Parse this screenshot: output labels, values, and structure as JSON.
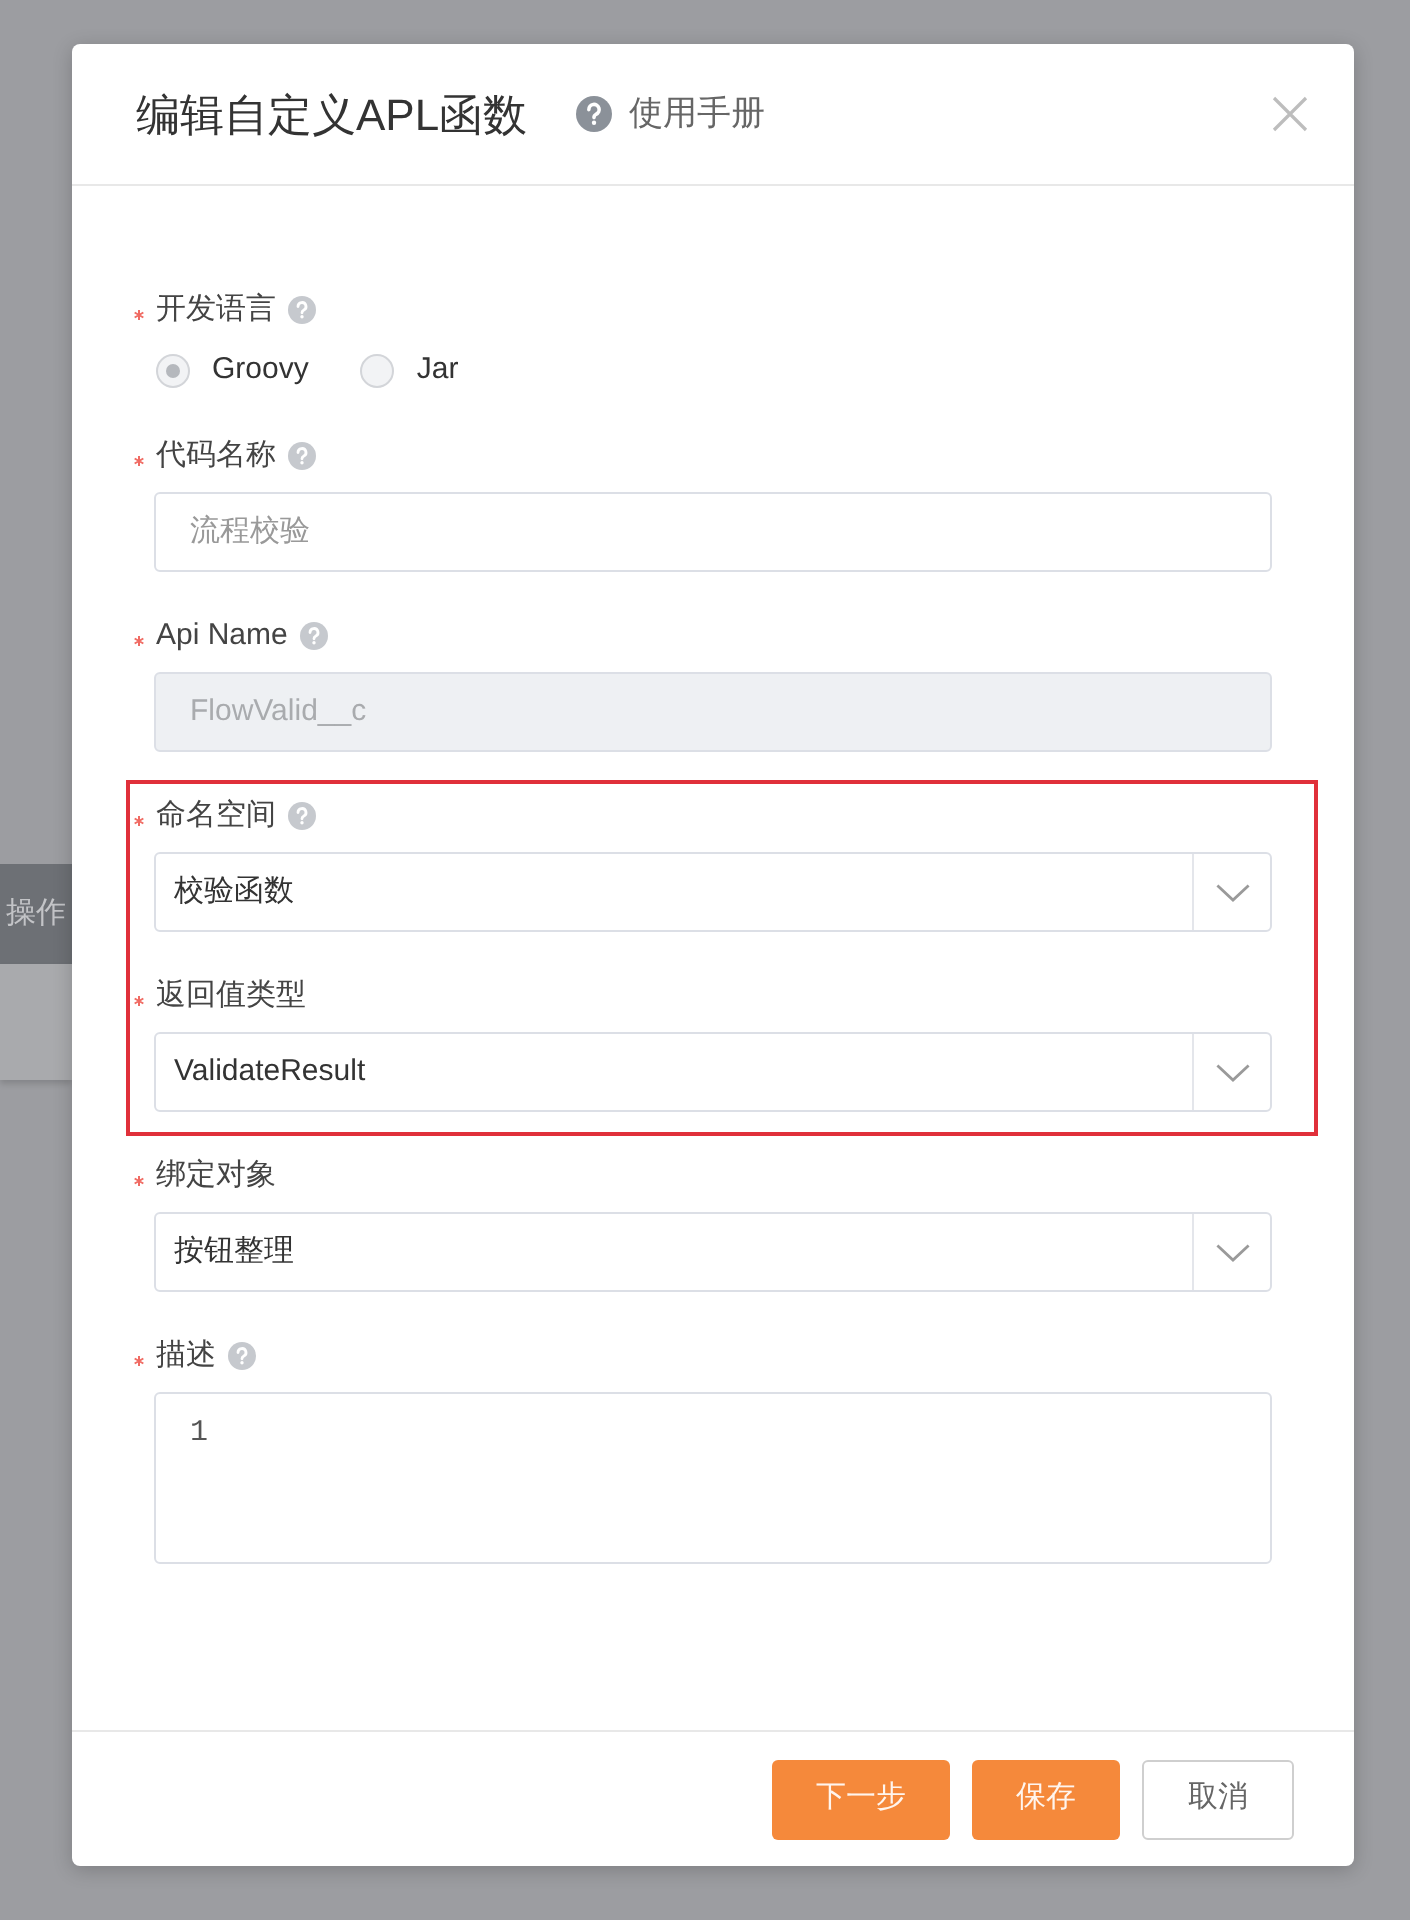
{
  "background": {
    "column_header": "操作"
  },
  "dialog": {
    "title": "编辑自定义APL函数",
    "help_link": "使用手册"
  },
  "fields": [
    {
      "kind": "radio",
      "label": "开发语言",
      "required": true,
      "help": true,
      "highlighted": false,
      "options": [
        {
          "label": "Groovy",
          "selected": true
        },
        {
          "label": "Jar",
          "selected": false
        }
      ]
    },
    {
      "kind": "text",
      "label": "代码名称",
      "required": true,
      "help": true,
      "highlighted": false,
      "value": "流程校验",
      "disabled": false
    },
    {
      "kind": "text",
      "label": "Api Name",
      "required": true,
      "help": true,
      "highlighted": false,
      "value": "FlowValid__c",
      "disabled": true
    },
    {
      "kind": "select",
      "label": "命名空间",
      "required": true,
      "help": true,
      "highlighted": true,
      "value": "校验函数"
    },
    {
      "kind": "select",
      "label": "返回值类型",
      "required": true,
      "help": false,
      "highlighted": true,
      "value": "ValidateResult"
    },
    {
      "kind": "select",
      "label": "绑定对象",
      "required": true,
      "help": false,
      "highlighted": false,
      "value": "按钮整理"
    },
    {
      "kind": "textarea",
      "label": "描述",
      "required": true,
      "help": true,
      "highlighted": false,
      "value": "1"
    }
  ],
  "buttons": [
    {
      "label": "下一步",
      "kind": "primary"
    },
    {
      "label": "保存",
      "kind": "primary"
    },
    {
      "label": "取消",
      "kind": "default"
    }
  ]
}
